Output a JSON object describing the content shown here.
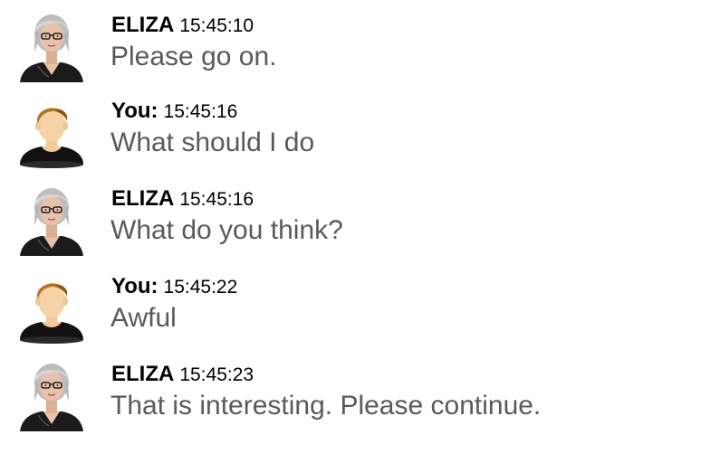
{
  "messages": [
    {
      "sender": "ELIZA",
      "time": "15:45:10",
      "text": "Please go on.",
      "avatar": "eliza-avatar"
    },
    {
      "sender": "You:",
      "time": "15:45:16",
      "text": "What should I do",
      "avatar": "user-avatar"
    },
    {
      "sender": "ELIZA",
      "time": "15:45:16",
      "text": "What do you think?",
      "avatar": "eliza-avatar"
    },
    {
      "sender": "You:",
      "time": "15:45:22",
      "text": "Awful",
      "avatar": "user-avatar"
    },
    {
      "sender": "ELIZA",
      "time": "15:45:23",
      "text": "That is interesting. Please continue.",
      "avatar": "eliza-avatar"
    }
  ],
  "colors": {
    "sender": "#000000",
    "message_text": "#5a5a5a",
    "user_hair": "#b8731f",
    "user_skin": "#f6d3a6",
    "user_shirt": "#111111",
    "eliza_hair": "#c9c9c9",
    "eliza_skin": "#e8c2a8",
    "eliza_shirt": "#1b1b1b"
  }
}
